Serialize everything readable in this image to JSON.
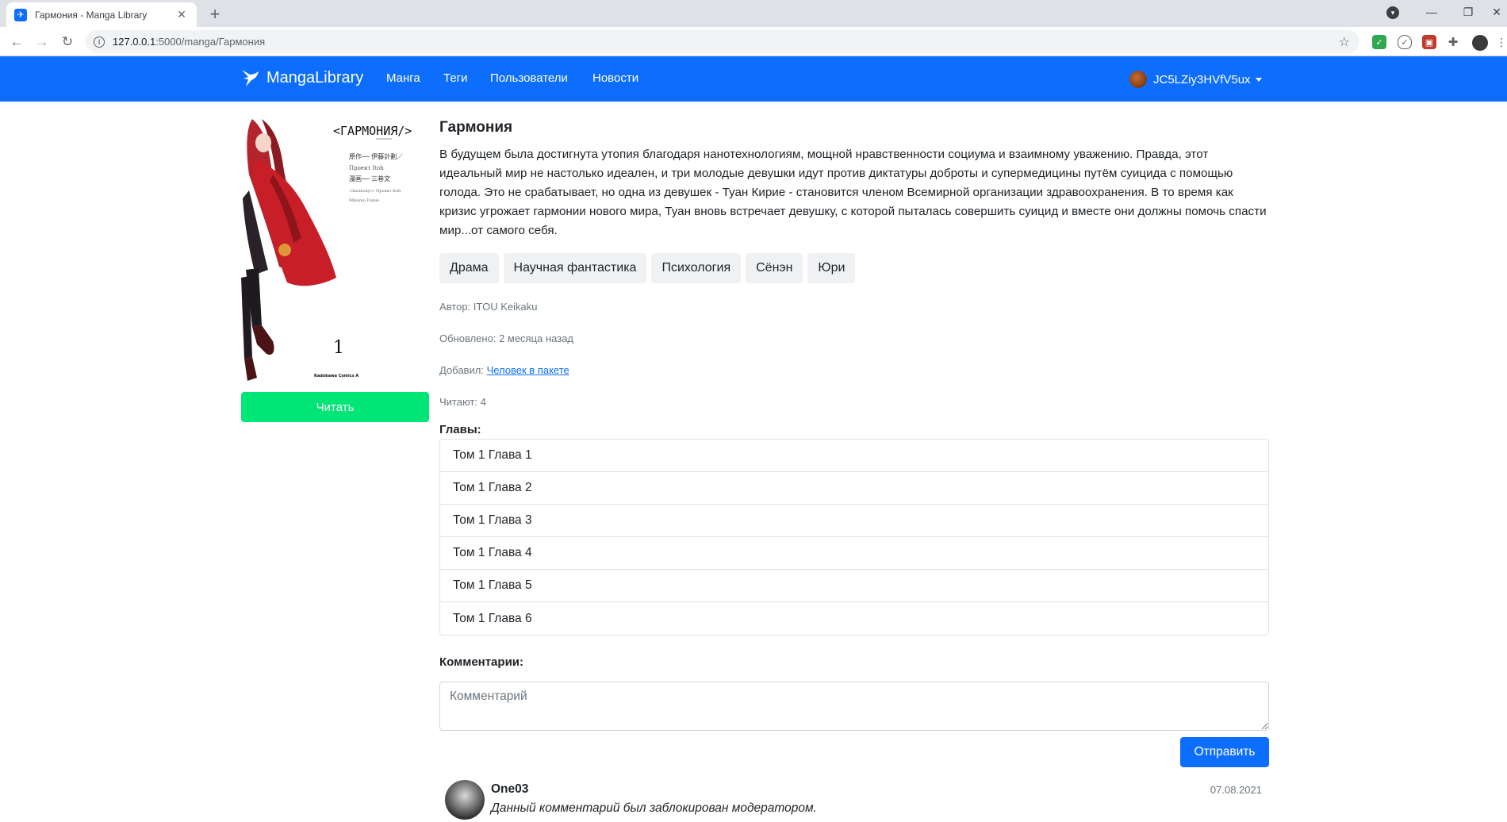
{
  "browser": {
    "tab_title": "Гармония - Manga Library",
    "tab_close": "✕",
    "new_tab": "+",
    "url_host": "127.0.0.1",
    "url_rest": ":5000/manga/Гармония"
  },
  "navbar": {
    "brand": "MangaLibrary",
    "links": [
      "Манга",
      "Теги",
      "Пользователи",
      "Новости"
    ],
    "username": "JC5LZiy3HVfV5ux"
  },
  "cover": {
    "title_text": "<ГАРМОНИЯ/>",
    "credits": [
      "原作── 伊藤計劃／",
      "Проект Itoh",
      "漫画── 三巷文",
      "<harmony/> Проект Itoh",
      "Mikumo Fumio"
    ],
    "volume": "1",
    "publisher": "Kadokawa Comics A"
  },
  "read_button": "Читать",
  "manga": {
    "title": "Гармония",
    "description": "В будущем была достигнута утопия благодаря нанотехнологиям, мощной нравственности социума и взаимному уважению. Правда, этот идеальный мир не настолько идеален, и три молодые девушки идут против диктатуры доброты и супермедицины путём суицида с помощью голода. Это не срабатывает, но одна из девушек - Туан Кирие - становится членом Всемирной организации здравоохранения. В то время как кризис угрожает гармонии нового мира, Туан вновь встречает девушку, с которой пыталась совершить суицид и вместе они должны помочь спасти мир...от самого себя.",
    "tags": [
      "Драма",
      "Научная фантастика",
      "Психология",
      "Сёнэн",
      "Юри"
    ],
    "author_label": "Автор:",
    "author": "ITOU Keikaku",
    "updated_label": "Обновлено:",
    "updated": "2 месяца назад",
    "added_label": "Добавил:",
    "added_by": "Человек в пакете",
    "readers_label": "Читают:",
    "readers": "4"
  },
  "chapters_label": "Главы:",
  "chapters": [
    "Том 1 Глава 1",
    "Том 1 Глава 2",
    "Том 1 Глава 3",
    "Том 1 Глава 4",
    "Том 1 Глава 5",
    "Том 1 Глава 6"
  ],
  "comments_label": "Комментарии:",
  "comment_placeholder": "Комментарий",
  "send_button": "Отправить",
  "comments": [
    {
      "author": "One03",
      "text": "Данный комментарий был заблокирован модератором.",
      "date": "07.08.2021"
    }
  ],
  "colors": {
    "primary": "#0d6efd",
    "read_button": "#00e676",
    "tag_bg": "#f0f1f3"
  }
}
